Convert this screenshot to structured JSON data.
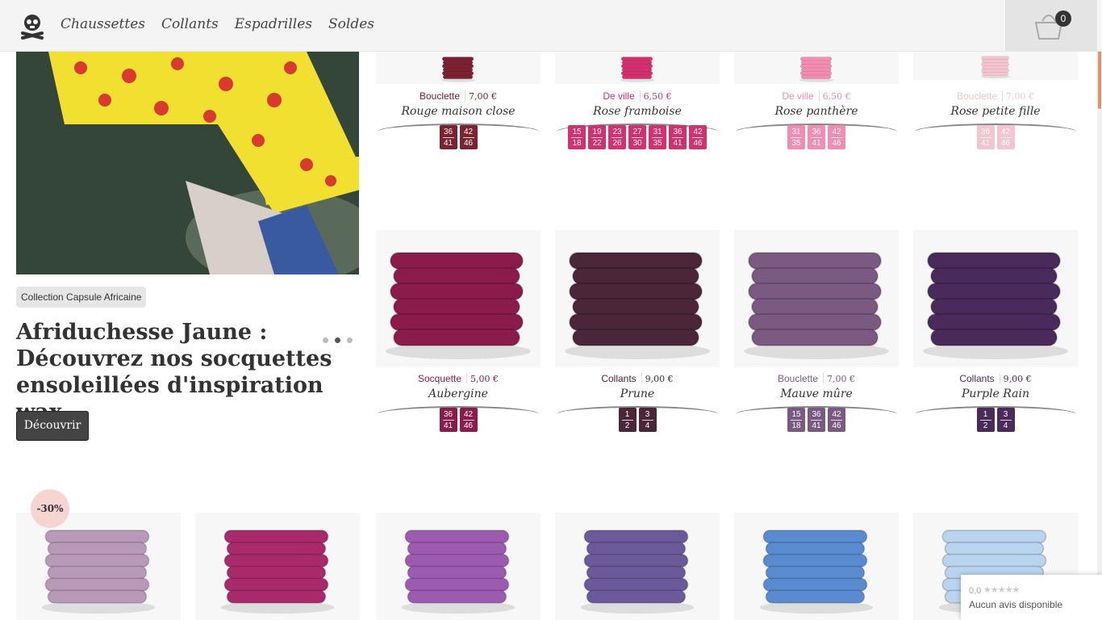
{
  "header": {
    "nav": [
      "Chaussettes",
      "Collants",
      "Espadrilles",
      "Soldes"
    ],
    "cart_count": "0"
  },
  "hero": {
    "tag": "Collection Capsule Africaine",
    "title": "Afriduchesse Jaune : Découvrez nos socquettes ensoleillées d'inspiration wax",
    "button": "Découvrir",
    "slides": 3,
    "active_slide": 2
  },
  "products_row1": [
    {
      "cat": "Bouclette",
      "price": "7,00 €",
      "name": "Rouge maison close",
      "color": "#7a2230",
      "sizes": [
        [
          "36",
          "41"
        ],
        [
          "42",
          "46"
        ]
      ]
    },
    {
      "cat": "De ville",
      "price": "6,50 €",
      "name": "Rose framboise",
      "color": "#d4306e",
      "sizes": [
        [
          "15",
          "18"
        ],
        [
          "19",
          "22"
        ],
        [
          "23",
          "26"
        ],
        [
          "27",
          "30"
        ],
        [
          "31",
          "35"
        ],
        [
          "36",
          "41"
        ],
        [
          "42",
          "46"
        ]
      ]
    },
    {
      "cat": "De ville",
      "price": "6,50 €",
      "name": "Rose panthère",
      "color": "#f28cb0",
      "sizes": [
        [
          "31",
          "35"
        ],
        [
          "36",
          "41"
        ],
        [
          "42",
          "46"
        ]
      ]
    },
    {
      "cat": "Bouclette",
      "price": "7,00 €",
      "name": "Rose petite fille",
      "color": "#f4c4d0",
      "sizes": [
        [
          "36",
          "41"
        ],
        [
          "42",
          "46"
        ]
      ]
    }
  ],
  "products_row2": [
    {
      "cat": "Socquette",
      "price": "5,00 €",
      "name": "Aubergine",
      "color": "#8b1c4a",
      "sizes": [
        [
          "36",
          "41"
        ],
        [
          "42",
          "46"
        ]
      ]
    },
    {
      "cat": "Collants",
      "price": "9,00 €",
      "name": "Prune",
      "color": "#4a2638",
      "sizes": [
        [
          "1",
          "2"
        ],
        [
          "3",
          "4"
        ]
      ]
    },
    {
      "cat": "Bouclette",
      "price": "7,00 €",
      "name": "Mauve mûre",
      "color": "#7a5a80",
      "sizes": [
        [
          "15",
          "18"
        ],
        [
          "36",
          "41"
        ],
        [
          "42",
          "46"
        ]
      ]
    },
    {
      "cat": "Collants",
      "price": "9,00 €",
      "name": "Purple Rain",
      "color": "#4a2a5a",
      "sizes": [
        [
          "1",
          "2"
        ],
        [
          "3",
          "4"
        ]
      ]
    }
  ],
  "products_row3": [
    {
      "color": "#b89ab8"
    },
    {
      "color": "#a82a6a"
    },
    {
      "color": "#9c5ab0"
    },
    {
      "color": "#6a5a9a"
    },
    {
      "color": "#5a8ad0"
    },
    {
      "color": "#b8d4ee"
    }
  ],
  "discount_badge": "-30%",
  "reviews": {
    "score": "0,0",
    "text": "Aucun avis disponible"
  }
}
